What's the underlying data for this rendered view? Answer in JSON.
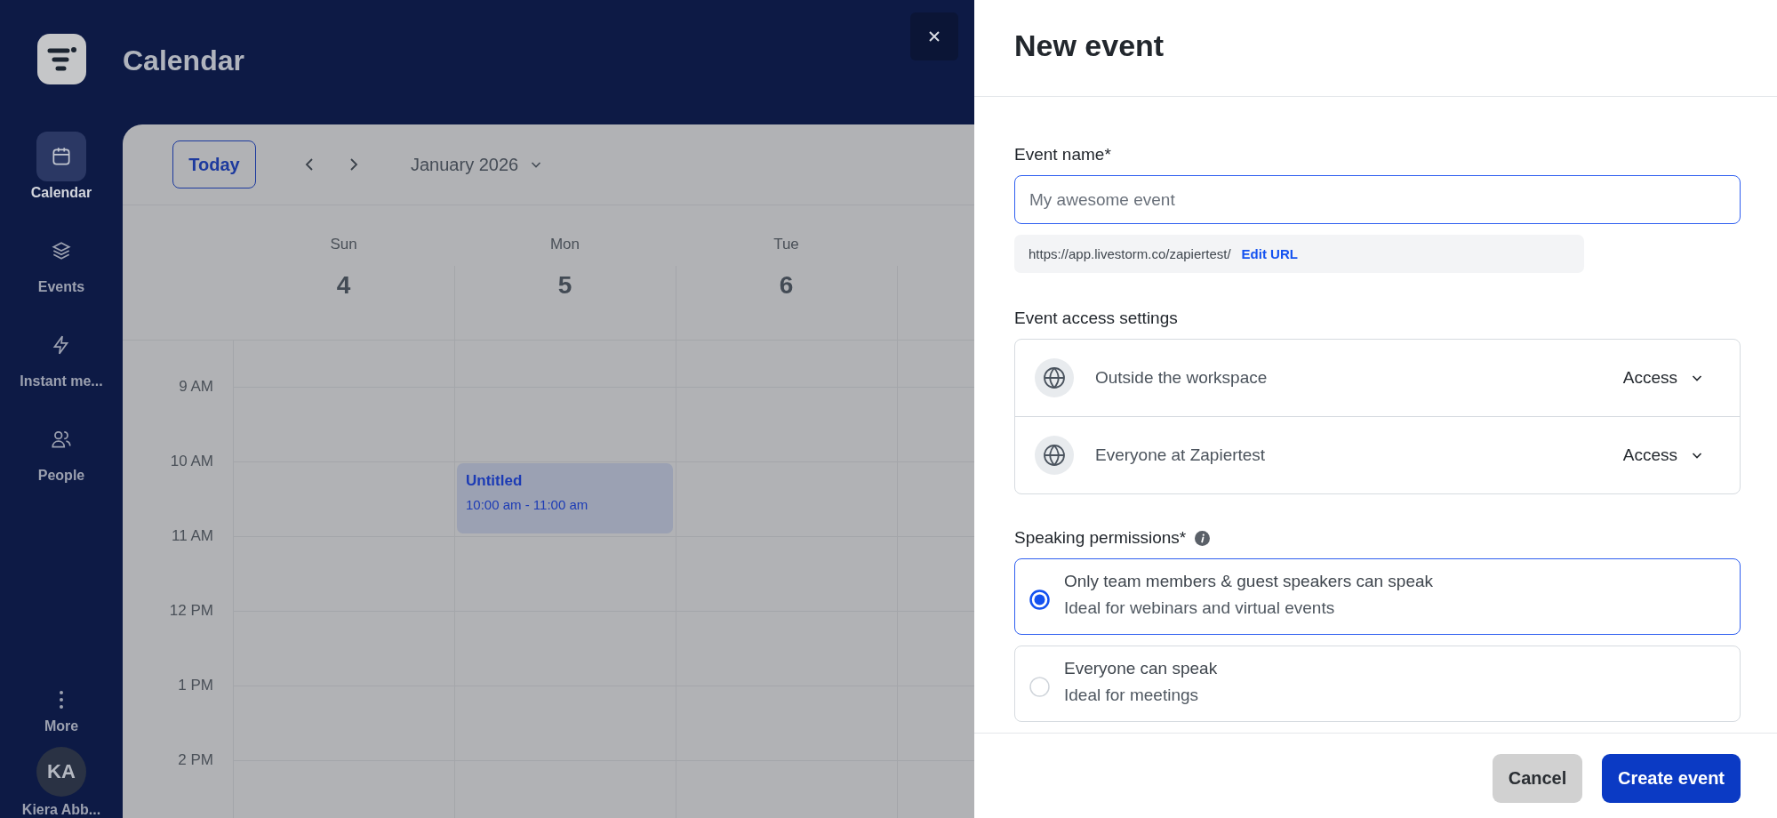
{
  "app": {
    "title": "Calendar"
  },
  "sidebar": {
    "items": [
      {
        "label": "Calendar",
        "selected": true
      },
      {
        "label": "Events",
        "selected": false
      },
      {
        "label": "Instant me...",
        "selected": false
      },
      {
        "label": "People",
        "selected": false
      }
    ],
    "more": "More",
    "user": {
      "initials": "KA",
      "name": "Kiera Abb..."
    }
  },
  "calendar": {
    "today": "Today",
    "month": "January 2026",
    "days": [
      {
        "name": "Sun",
        "date": "4"
      },
      {
        "name": "Mon",
        "date": "5",
        "events": [
          {
            "title": "Untitled",
            "time": "10:00 am - 11:00 am"
          }
        ]
      },
      {
        "name": "Tue",
        "date": "6"
      }
    ],
    "hours": [
      "9 AM",
      "10 AM",
      "11 AM",
      "12 PM",
      "1 PM",
      "2 PM"
    ]
  },
  "panel": {
    "title": "New event",
    "event_name": {
      "label": "Event name*",
      "placeholder": "My awesome event"
    },
    "url": {
      "text": "https://app.livestorm.co/zapiertest/",
      "link": "Edit URL"
    },
    "access": {
      "label": "Event access settings",
      "rows": [
        {
          "name": "Outside the workspace",
          "action": "Access"
        },
        {
          "name": "Everyone at Zapiertest",
          "action": "Access"
        }
      ]
    },
    "speaking": {
      "label": "Speaking permissions*",
      "options": [
        {
          "title": "Only team members & guest speakers can speak",
          "description": "Ideal for webinars and virtual events",
          "selected": true
        },
        {
          "title": "Everyone can speak",
          "description": "Ideal for meetings",
          "selected": false
        }
      ]
    },
    "buttons": [
      {
        "label": "Cancel",
        "kind": "secondary"
      },
      {
        "label": "Create event",
        "kind": "primary"
      }
    ]
  }
}
